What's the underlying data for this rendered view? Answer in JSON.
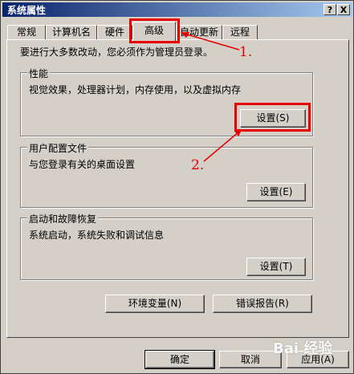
{
  "window": {
    "title": "系统属性",
    "help_button": "?",
    "close_button": "X"
  },
  "tabs": [
    {
      "label": "常规"
    },
    {
      "label": "计算机名"
    },
    {
      "label": "硬件"
    },
    {
      "label": "高级"
    },
    {
      "label": "自动更新"
    },
    {
      "label": "远程"
    }
  ],
  "intro": "要进行大多数改动，您必须作为管理员登录。",
  "performance": {
    "title": "性能",
    "description": "视觉效果，处理器计划，内存使用，以及虚拟内存",
    "button": "设置(S)"
  },
  "profiles": {
    "title": "用户配置文件",
    "description": "与您登录有关的桌面设置",
    "button": "设置(E)"
  },
  "startup": {
    "title": "启动和故障恢复",
    "description": "系统启动，系统失败和调试信息",
    "button": "设置(T)"
  },
  "env_button": "环境变量(N)",
  "error_button": "错误报告(R)",
  "footer": {
    "ok": "确定",
    "cancel": "取消",
    "apply": "应用(A)"
  },
  "annotations": {
    "step1": "1.",
    "step2": "2.",
    "accent_color": "#e60000"
  },
  "watermark": "Bai 经验"
}
